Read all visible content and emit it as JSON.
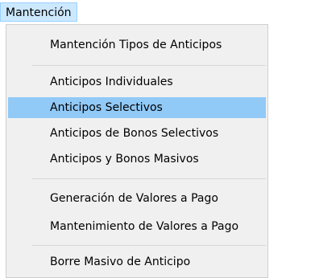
{
  "menubar": {
    "active_menu_label": "Mantención"
  },
  "menu": {
    "items": [
      {
        "label": "Mantención Tipos de Anticipos"
      },
      {
        "label": "Anticipos Individuales"
      },
      {
        "label": "Anticipos Selectivos"
      },
      {
        "label": "Anticipos de Bonos Selectivos"
      },
      {
        "label": "Anticipos y Bonos Masivos"
      },
      {
        "label": "Generación de Valores a Pago"
      },
      {
        "label": "Mantenimiento de Valores a Pago"
      },
      {
        "label": "Borre Masivo de Anticipo"
      }
    ]
  },
  "colors": {
    "menubar_active_bg": "#cce8ff",
    "highlight_bg": "#91c9f7",
    "menu_bg": "#f0f0f0"
  }
}
